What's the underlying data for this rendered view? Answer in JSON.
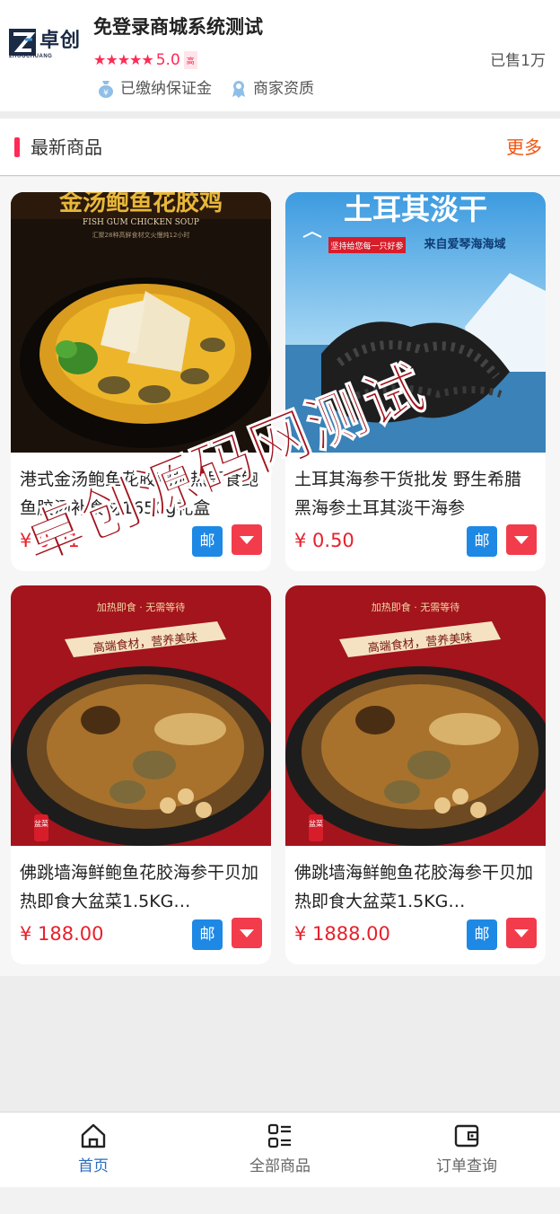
{
  "shop": {
    "logo_cn": "卓创",
    "logo_en": "ZHUOCHUANG",
    "name": "免登录商城系统测试",
    "stars": "★★★★★",
    "score": "5.0",
    "level": "高",
    "sold": "已售1万",
    "badges": [
      {
        "icon": "bag-icon",
        "label": "已缴纳保证金"
      },
      {
        "icon": "qualification-icon",
        "label": "商家资质"
      }
    ]
  },
  "section": {
    "title": "最新商品",
    "more": "更多"
  },
  "products": [
    {
      "title": "港式金汤鲍鱼花胶鸡加热即食鲍鱼胶汤补食材1650g礼盒",
      "price": "¥ 0.01",
      "mail": "邮",
      "image_text": "金汤鲍鱼花胶鸡",
      "image_sub": "FISH GUM CHICKEN SOUP",
      "image_sub2": "汇聚28种高鲜食材文火慢炖12小时"
    },
    {
      "title": "土耳其海参干货批发 野生希腊黑海参土耳其淡干海参",
      "price": "¥ 0.50",
      "mail": "邮",
      "image_text": "土耳其淡干",
      "image_sub": "来自爱琴海海域",
      "image_sub2": "坚持给您每一只好参"
    },
    {
      "title": "佛跳墙海鲜鲍鱼花胶海参干贝加热即食大盆菜1.5KG…",
      "price": "¥ 188.00",
      "mail": "邮",
      "image_text": "高端食材，营养美味",
      "image_sub": "加热即食 · 无需等待",
      "image_sub2": "盆菜"
    },
    {
      "title": "佛跳墙海鲜鲍鱼花胶海参干贝加热即食大盆菜1.5KG…",
      "price": "¥ 1888.00",
      "mail": "邮",
      "image_text": "高端食材，营养美味",
      "image_sub": "加热即食 · 无需等待",
      "image_sub2": "盆菜"
    }
  ],
  "watermark": "卓创源码网测试",
  "tabbar": [
    {
      "icon": "home-icon",
      "label": "首页",
      "active": true
    },
    {
      "icon": "grid-list-icon",
      "label": "全部商品",
      "active": false
    },
    {
      "icon": "wallet-icon",
      "label": "订单查询",
      "active": false
    }
  ],
  "colors": {
    "accent": "#ff2a55",
    "more": "#f35410",
    "price": "#e8202c",
    "mail_btn": "#1e88e5",
    "more_btn": "#f23c4c",
    "tab_active": "#2a6cc0"
  }
}
